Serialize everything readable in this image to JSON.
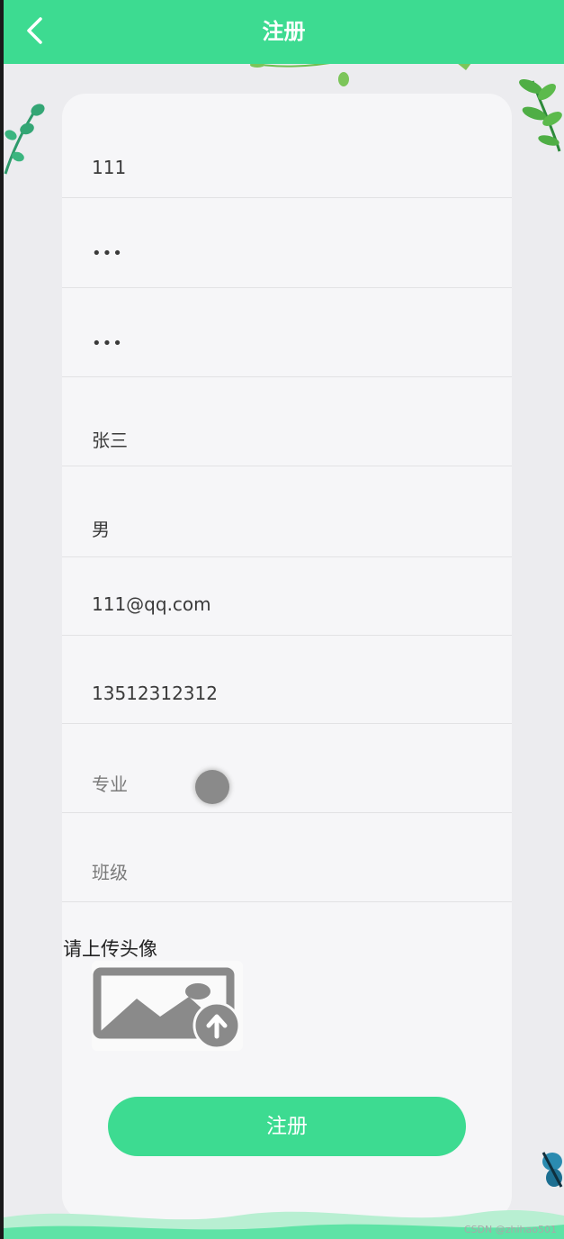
{
  "header": {
    "title": "注册",
    "back_icon": "chevron-left-icon"
  },
  "form": {
    "fields": [
      {
        "name": "username",
        "value": "111",
        "placeholder": ""
      },
      {
        "name": "password",
        "value": "•••",
        "placeholder": ""
      },
      {
        "name": "confirm-password",
        "value": "•••",
        "placeholder": ""
      },
      {
        "name": "real-name",
        "value": "张三",
        "placeholder": ""
      },
      {
        "name": "gender",
        "value": "男",
        "placeholder": ""
      },
      {
        "name": "email",
        "value": "111@qq.com",
        "placeholder": ""
      },
      {
        "name": "phone",
        "value": "13512312312",
        "placeholder": ""
      },
      {
        "name": "major",
        "value": "",
        "placeholder": "专业"
      },
      {
        "name": "class",
        "value": "",
        "placeholder": "班级"
      }
    ],
    "avatar_label": "请上传头像",
    "avatar_icon": "image-upload-icon",
    "submit_label": "注册"
  },
  "watermark": "CSDN @zhihao501",
  "colors": {
    "accent": "#3ddb91",
    "card": "#f6f6f8",
    "background": "#ececef"
  }
}
